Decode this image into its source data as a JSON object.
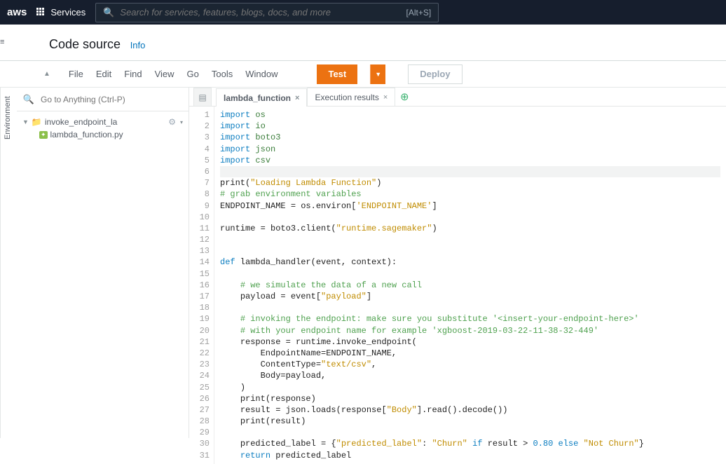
{
  "topnav": {
    "logo": "aws",
    "services": "Services",
    "search_placeholder": "Search for services, features, blogs, docs, and more",
    "search_hint": "[Alt+S]"
  },
  "section": {
    "title": "Code source",
    "info": "Info"
  },
  "menubar": {
    "items": [
      "File",
      "Edit",
      "Find",
      "View",
      "Go",
      "Tools",
      "Window"
    ],
    "test": "Test",
    "deploy": "Deploy"
  },
  "leftcol": {
    "goto_placeholder": "Go to Anything (Ctrl-P)",
    "env_label": "Environment",
    "folder": "invoke_endpoint_la",
    "file": "lambda_function.py"
  },
  "tabs": {
    "tab1": "lambda_function",
    "tab2": "Execution results"
  },
  "code": {
    "lines": [
      {
        "n": 1,
        "tokens": [
          [
            "kw",
            "import"
          ],
          [
            "sp",
            " "
          ],
          [
            "mod",
            "os"
          ]
        ]
      },
      {
        "n": 2,
        "tokens": [
          [
            "kw",
            "import"
          ],
          [
            "sp",
            " "
          ],
          [
            "mod",
            "io"
          ]
        ]
      },
      {
        "n": 3,
        "tokens": [
          [
            "kw",
            "import"
          ],
          [
            "sp",
            " "
          ],
          [
            "mod",
            "boto3"
          ]
        ]
      },
      {
        "n": 4,
        "tokens": [
          [
            "kw",
            "import"
          ],
          [
            "sp",
            " "
          ],
          [
            "mod",
            "json"
          ]
        ]
      },
      {
        "n": 5,
        "tokens": [
          [
            "kw",
            "import"
          ],
          [
            "sp",
            " "
          ],
          [
            "mod",
            "csv"
          ]
        ]
      },
      {
        "n": 6,
        "hl": true,
        "tokens": []
      },
      {
        "n": 7,
        "tokens": [
          [
            "fn",
            "print("
          ],
          [
            "str",
            "\"Loading Lambda Function\""
          ],
          [
            "fn",
            ")"
          ]
        ]
      },
      {
        "n": 8,
        "tokens": [
          [
            "com",
            "# grab environment variables"
          ]
        ]
      },
      {
        "n": 9,
        "tokens": [
          [
            "fn",
            "ENDPOINT_NAME = os.environ["
          ],
          [
            "str",
            "'ENDPOINT_NAME'"
          ],
          [
            "fn",
            "]"
          ]
        ]
      },
      {
        "n": 10,
        "tokens": []
      },
      {
        "n": 11,
        "tokens": [
          [
            "fn",
            "runtime = boto3.client("
          ],
          [
            "str",
            "\"runtime.sagemaker\""
          ],
          [
            "fn",
            ")"
          ]
        ]
      },
      {
        "n": 12,
        "tokens": []
      },
      {
        "n": 13,
        "tokens": []
      },
      {
        "n": 14,
        "tokens": [
          [
            "kw",
            "def"
          ],
          [
            "fn",
            " lambda_handler(event, context):"
          ]
        ]
      },
      {
        "n": 15,
        "tokens": []
      },
      {
        "n": 16,
        "tokens": [
          [
            "sp",
            "    "
          ],
          [
            "com",
            "# we simulate the data of a new call"
          ]
        ]
      },
      {
        "n": 17,
        "tokens": [
          [
            "sp",
            "    "
          ],
          [
            "fn",
            "payload = event["
          ],
          [
            "str",
            "\"payload\""
          ],
          [
            "fn",
            "]"
          ]
        ]
      },
      {
        "n": 18,
        "tokens": []
      },
      {
        "n": 19,
        "tokens": [
          [
            "sp",
            "    "
          ],
          [
            "com",
            "# invoking the endpoint: make sure you substitute '<insert-your-endpoint-here>'"
          ]
        ]
      },
      {
        "n": 20,
        "tokens": [
          [
            "sp",
            "    "
          ],
          [
            "com",
            "# with your endpoint name for example 'xgboost-2019-03-22-11-38-32-449'"
          ]
        ]
      },
      {
        "n": 21,
        "tokens": [
          [
            "sp",
            "    "
          ],
          [
            "fn",
            "response = runtime.invoke_endpoint("
          ]
        ]
      },
      {
        "n": 22,
        "tokens": [
          [
            "sp",
            "        "
          ],
          [
            "fn",
            "EndpointName=ENDPOINT_NAME,"
          ]
        ]
      },
      {
        "n": 23,
        "tokens": [
          [
            "sp",
            "        "
          ],
          [
            "fn",
            "ContentType="
          ],
          [
            "str",
            "\"text/csv\""
          ],
          [
            "fn",
            ","
          ]
        ]
      },
      {
        "n": 24,
        "tokens": [
          [
            "sp",
            "        "
          ],
          [
            "fn",
            "Body=payload,"
          ]
        ]
      },
      {
        "n": 25,
        "tokens": [
          [
            "sp",
            "    "
          ],
          [
            "fn",
            ")"
          ]
        ]
      },
      {
        "n": 26,
        "tokens": [
          [
            "sp",
            "    "
          ],
          [
            "fn",
            "print(response)"
          ]
        ]
      },
      {
        "n": 27,
        "tokens": [
          [
            "sp",
            "    "
          ],
          [
            "fn",
            "result = json.loads(response["
          ],
          [
            "str",
            "\"Body\""
          ],
          [
            "fn",
            "].read().decode())"
          ]
        ]
      },
      {
        "n": 28,
        "tokens": [
          [
            "sp",
            "    "
          ],
          [
            "fn",
            "print(result)"
          ]
        ]
      },
      {
        "n": 29,
        "tokens": []
      },
      {
        "n": 30,
        "tokens": [
          [
            "sp",
            "    "
          ],
          [
            "fn",
            "predicted_label = {"
          ],
          [
            "str",
            "\"predicted_label\""
          ],
          [
            "fn",
            ": "
          ],
          [
            "str",
            "\"Churn\""
          ],
          [
            "fn",
            " "
          ],
          [
            "kw",
            "if"
          ],
          [
            "fn",
            " result > "
          ],
          [
            "num",
            "0.80"
          ],
          [
            "fn",
            " "
          ],
          [
            "kw",
            "else"
          ],
          [
            "fn",
            " "
          ],
          [
            "str",
            "\"Not Churn\""
          ],
          [
            "fn",
            "}"
          ]
        ]
      },
      {
        "n": 31,
        "tokens": [
          [
            "sp",
            "    "
          ],
          [
            "kw",
            "return"
          ],
          [
            "fn",
            " predicted_label"
          ]
        ]
      }
    ]
  }
}
